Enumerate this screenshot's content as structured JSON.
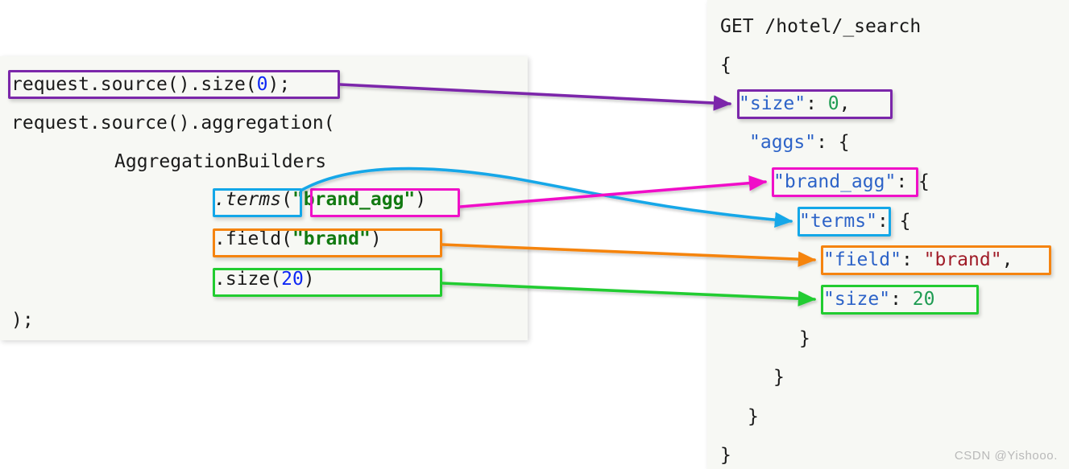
{
  "left_panel": {
    "name": "java-code-panel",
    "lines": [
      {
        "id": "line1",
        "text": "request.source().size(",
        "num": "0",
        "tail": ");"
      },
      {
        "id": "line2",
        "text": "request.source().aggregation("
      },
      {
        "id": "line3",
        "text": "AggregationBuilders"
      },
      {
        "id": "line4_method",
        "text": ".terms",
        "open": "(",
        "arg": "\"brand_agg\"",
        "close": ")"
      },
      {
        "id": "line5_field",
        "text": ".field(",
        "arg": "\"brand\"",
        "close": ")"
      },
      {
        "id": "line6_size",
        "text": ".size(",
        "num": "20",
        "close": ")"
      },
      {
        "id": "line7",
        "text": ");"
      }
    ],
    "highlight_labels": {
      "size_zero": "request.source().size(0);",
      "terms": ".terms",
      "brand_agg": "\"brand_agg\"",
      "field_brand": ".field(\"brand\")",
      "size_twenty": ".size(20)"
    }
  },
  "right_panel": {
    "name": "elasticsearch-dsl-panel",
    "request_line": "GET /hotel/_search",
    "lines": [
      {
        "id": "open_brace",
        "indent": 0,
        "text": "{"
      },
      {
        "id": "size_0",
        "indent": 1,
        "key": "\"size\"",
        "sep": ": ",
        "num": "0",
        "tail": ","
      },
      {
        "id": "aggs",
        "indent": 1,
        "key": "\"aggs\"",
        "sep": ": ",
        "tail": "{"
      },
      {
        "id": "brand_agg",
        "indent": 2,
        "key": "\"brand_agg\"",
        "sep": ": ",
        "tail": "{"
      },
      {
        "id": "terms",
        "indent": 3,
        "key": "\"terms\"",
        "sep": ": ",
        "tail": "{"
      },
      {
        "id": "field_brand",
        "indent": 4,
        "key": "\"field\"",
        "sep": ": ",
        "str": "\"brand\"",
        "tail": ","
      },
      {
        "id": "size_20",
        "indent": 4,
        "key": "\"size\"",
        "sep": ": ",
        "num": "20"
      },
      {
        "id": "close4",
        "indent": 3,
        "text": "}"
      },
      {
        "id": "close3",
        "indent": 2,
        "text": "}"
      },
      {
        "id": "close2",
        "indent": 1,
        "text": "}"
      },
      {
        "id": "close1",
        "indent": 0,
        "text": "}"
      }
    ]
  },
  "mappings": [
    {
      "id": "map-size-zero",
      "color_name": "purple",
      "color": "#7b27aa",
      "from": "request.source().size(0);",
      "to": "\"size\": 0,"
    },
    {
      "id": "map-terms",
      "color_name": "cyan",
      "color": "#13a7e8",
      "from": ".terms",
      "to": "\"terms\""
    },
    {
      "id": "map-brand-agg",
      "color_name": "magenta",
      "color": "#f010c8",
      "from": "\"brand_agg\"",
      "to": "\"brand_agg\""
    },
    {
      "id": "map-field",
      "color_name": "orange",
      "color": "#f58410",
      "from": ".field(\"brand\")",
      "to": "\"field\": \"brand\","
    },
    {
      "id": "map-size",
      "color_name": "green",
      "color": "#21cc30",
      "from": ".size(20)",
      "to": "\"size\": 20"
    }
  ],
  "colors": {
    "panel_background": "#f7f8f4",
    "page_background": "#ffffff",
    "code_text": "#1a1a1a",
    "number_literal": "#0d27f5",
    "string_literal": "#127a12",
    "json_key": "#2d63c8",
    "json_number": "#1f9c53",
    "json_string": "#a01c28",
    "watermark": "#b9b9b9"
  },
  "watermark": {
    "text": "CSDN @Yishooo."
  }
}
